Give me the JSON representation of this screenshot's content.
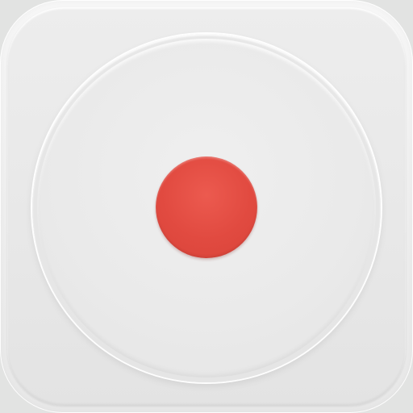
{
  "icon": {
    "name": "record-button-icon",
    "colors": {
      "tile_light": "#f6f6f6",
      "tile_base": "#e8e8e8",
      "dial": "#e9e9e9",
      "record_red": "#e14a40"
    }
  }
}
